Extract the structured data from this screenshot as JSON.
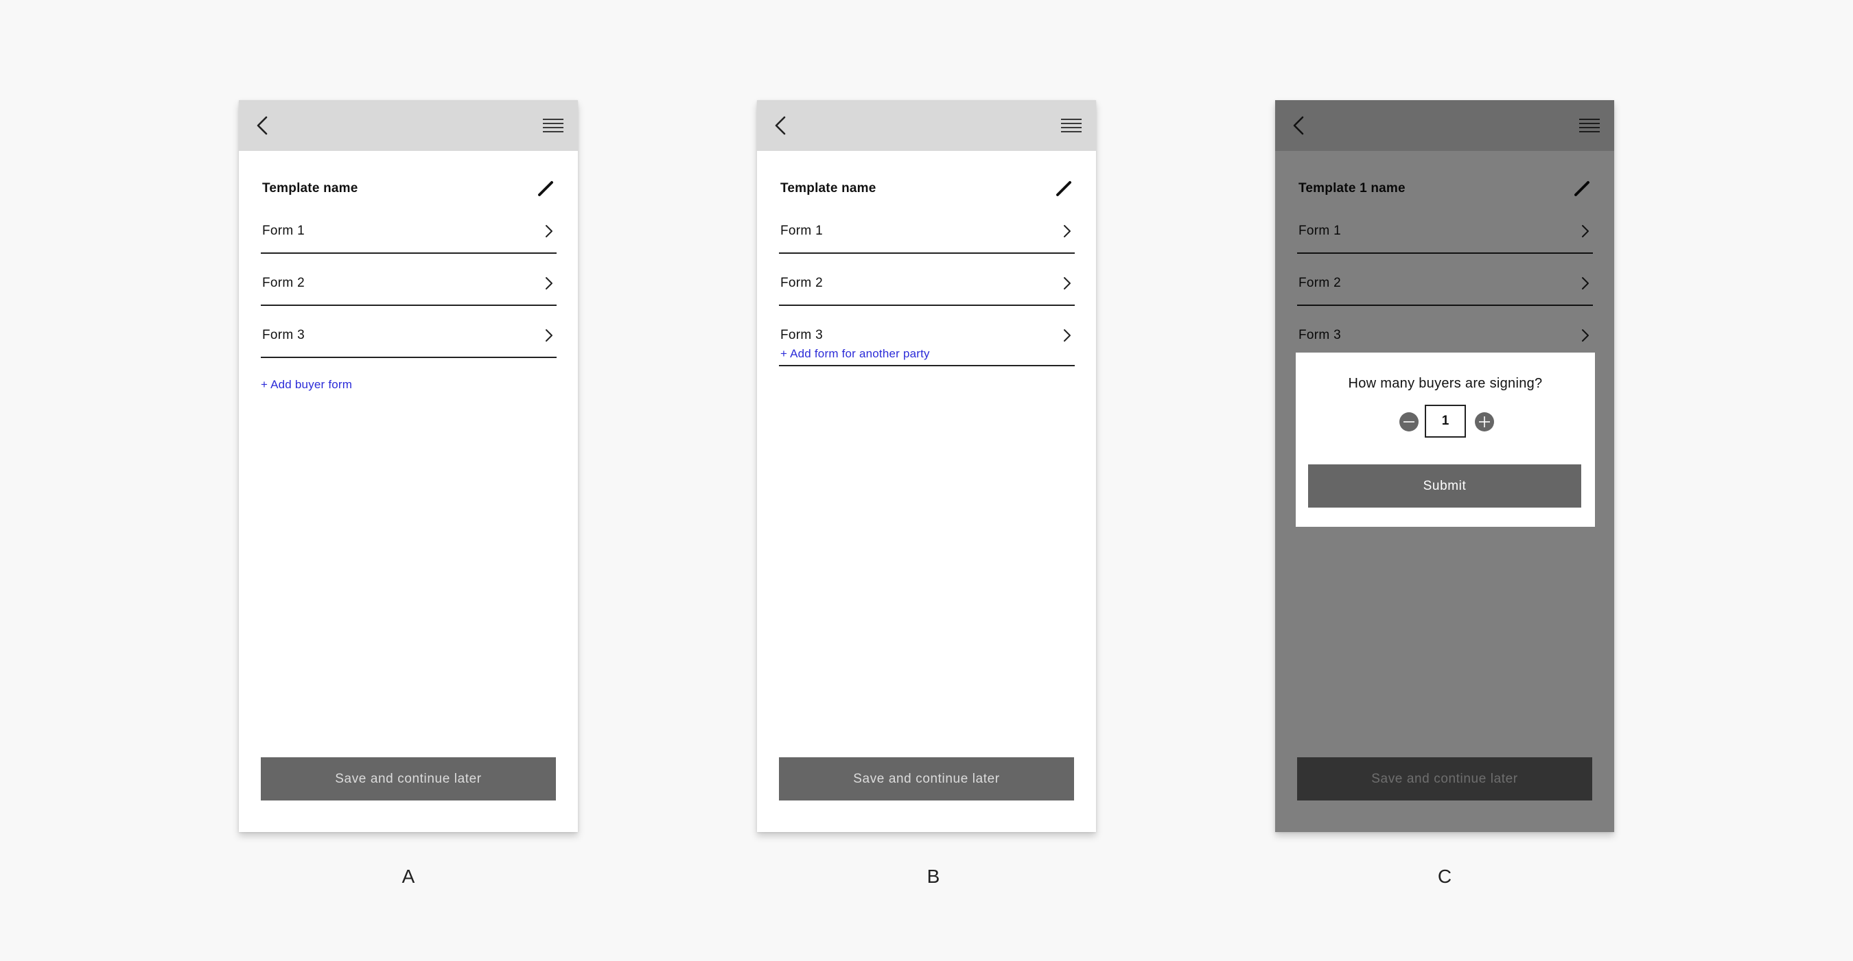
{
  "screens": [
    {
      "id": "A",
      "caption": "A",
      "template_title": "Template name",
      "forms": [
        {
          "label": "Form 1"
        },
        {
          "label": "Form 2"
        },
        {
          "label": "Form 3"
        }
      ],
      "add_link": "+ Add buyer form",
      "save_button": "Save and continue later"
    },
    {
      "id": "B",
      "caption": "B",
      "template_title": "Template name",
      "forms": [
        {
          "label": "Form 1"
        },
        {
          "label": "Form 2"
        },
        {
          "label": "Form 3"
        }
      ],
      "add_link": "+ Add form for another party",
      "save_button": "Save and continue later"
    },
    {
      "id": "C",
      "caption": "C",
      "template_title": "Template 1 name",
      "forms": [
        {
          "label": "Form 1"
        },
        {
          "label": "Form 2"
        },
        {
          "label": "Form 3"
        }
      ],
      "save_button": "Save and continue later",
      "modal": {
        "question": "How many buyers are signing?",
        "quantity": "1",
        "submit_label": "Submit"
      }
    }
  ],
  "colors": {
    "page_background": "#f8f8f8",
    "topbar": "#d9d9d9",
    "button_fill": "#666666",
    "link": "#2b2bd8",
    "overlay": "rgba(0,0,0,0.5)"
  },
  "icons": {
    "back": "chevron-left-icon",
    "menu": "hamburger-menu-icon",
    "edit": "pencil-icon",
    "row_arrow": "chevron-right-icon",
    "decrement": "minus-circle-icon",
    "increment": "plus-circle-icon"
  }
}
